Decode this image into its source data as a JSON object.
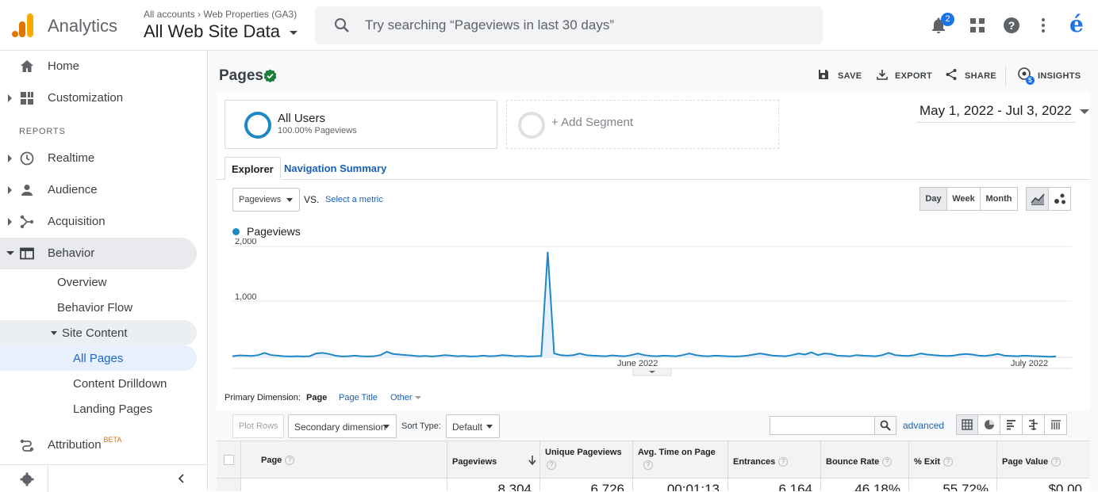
{
  "header": {
    "app_name": "Analytics",
    "crumb_accounts": "All accounts",
    "crumb_property": "Web Properties (GA3)",
    "view_name": "All Web Site Data",
    "search_placeholder": "Try searching “Pageviews in last 30 days”",
    "notification_count": "2",
    "avatar_letter": "é"
  },
  "sidebar": {
    "home": "Home",
    "customization": "Customization",
    "reports_header": "REPORTS",
    "realtime": "Realtime",
    "audience": "Audience",
    "acquisition": "Acquisition",
    "behavior": "Behavior",
    "overview": "Overview",
    "behavior_flow": "Behavior Flow",
    "site_content": "Site Content",
    "all_pages": "All Pages",
    "content_drilldown": "Content Drilldown",
    "landing_pages": "Landing Pages",
    "attribution": "Attribution",
    "beta": "BETA"
  },
  "page": {
    "title": "Pages",
    "save": "SAVE",
    "export": "EXPORT",
    "share": "SHARE",
    "insights": "INSIGHTS",
    "insights_badge": "5"
  },
  "segments": {
    "all_users": "All Users",
    "all_users_sub": "100.00% Pageviews",
    "add_segment": "+ Add Segment"
  },
  "date_range": "May 1, 2022 - Jul 3, 2022",
  "tabs": {
    "explorer": "Explorer",
    "navigation_summary": "Navigation Summary"
  },
  "controls": {
    "metric": "Pageviews",
    "vs": "VS.",
    "select_metric": "Select a metric",
    "day": "Day",
    "week": "Week",
    "month": "Month"
  },
  "chart_data": {
    "type": "line",
    "title": "",
    "series": [
      {
        "name": "Pageviews",
        "values": [
          20,
          35,
          30,
          25,
          40,
          80,
          40,
          30,
          20,
          15,
          20,
          15,
          20,
          70,
          80,
          60,
          30,
          15,
          20,
          30,
          20,
          15,
          20,
          40,
          100,
          60,
          50,
          40,
          30,
          20,
          25,
          15,
          25,
          40,
          30,
          20,
          25,
          15,
          20,
          30,
          20,
          25,
          40,
          30,
          20,
          25,
          15,
          20,
          25,
          1900,
          70,
          40,
          30,
          40,
          70,
          40,
          30,
          25,
          20,
          35,
          25,
          20,
          40,
          70,
          40,
          25,
          20,
          30,
          25,
          20,
          40,
          70,
          40,
          25,
          20,
          30,
          25,
          20,
          15,
          20,
          30,
          50,
          70,
          50,
          30,
          25,
          20,
          40,
          70,
          50,
          90,
          40,
          70,
          60,
          30,
          25,
          20,
          40,
          30,
          25,
          20,
          40,
          80,
          40,
          30,
          25,
          40,
          70,
          50,
          40,
          30,
          25,
          30,
          50,
          60,
          50,
          30,
          25,
          40,
          60,
          30,
          25,
          20,
          30,
          25,
          20,
          15,
          10,
          15
        ]
      }
    ],
    "y_ticks": [
      "2,000",
      "1,000"
    ],
    "x_labels": [
      "June 2022",
      "July 2022"
    ],
    "ylim": [
      0,
      2000
    ],
    "grid": true
  },
  "primary_dimension": {
    "label": "Primary Dimension:",
    "page": "Page",
    "page_title": "Page Title",
    "other": "Other"
  },
  "table_tools": {
    "plot_rows": "Plot Rows",
    "secondary_dimension": "Secondary dimension",
    "sort_type_label": "Sort Type:",
    "sort_type": "Default",
    "advanced": "advanced"
  },
  "table": {
    "columns": [
      "Page",
      "Pageviews",
      "Unique Pageviews",
      "Avg. Time on Page",
      "Entrances",
      "Bounce Rate",
      "% Exit",
      "Page Value"
    ],
    "first_row_partial": [
      "",
      "8,304",
      "6,726",
      "00:01:13",
      "6,164",
      "46.18%",
      "55.72%",
      "$0.00"
    ]
  }
}
